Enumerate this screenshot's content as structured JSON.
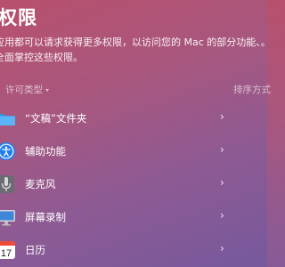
{
  "header": {
    "title": "权限",
    "description": "应用都可以请求获得更多权限，以访问您的 Mac 的部分功能、。全面掌控这些权限。"
  },
  "columns": {
    "permission_type": "许可类型",
    "sort": "排序方式"
  },
  "rows": [
    {
      "label": "“文稿”文件夹",
      "icon": "folder-icon"
    },
    {
      "label": "辅助功能",
      "icon": "accessibility-icon"
    },
    {
      "label": "麦克风",
      "icon": "microphone-icon"
    },
    {
      "label": "屏幕录制",
      "icon": "screen-recording-icon"
    },
    {
      "label": "日历",
      "icon": "calendar-icon",
      "day": "17"
    }
  ],
  "chevron": "›"
}
